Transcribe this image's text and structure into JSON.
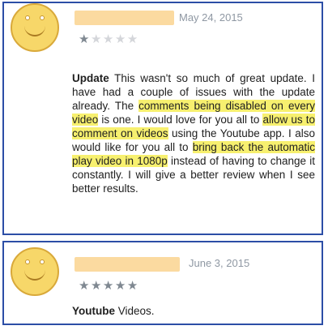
{
  "reviews": [
    {
      "date": "May 24, 2015",
      "rating": 1,
      "title": "Update",
      "segments": [
        {
          "text": " This wasn't so much of great update. I have had a couple of issues with the update already. The ",
          "highlight": false
        },
        {
          "text": "comments being disabled on every video",
          "highlight": true
        },
        {
          "text": " is one. I would love for you all to ",
          "highlight": false
        },
        {
          "text": "allow us to comment on videos",
          "highlight": true
        },
        {
          "text": " using the Youtube app. I also would like for you all to ",
          "highlight": false
        },
        {
          "text": "bring back the automatic play video in 1080p",
          "highlight": true
        },
        {
          "text": " instead of having to change it constantly. I will give a better review when I see better results.",
          "highlight": false
        }
      ]
    },
    {
      "date": "June 3, 2015",
      "rating": 5,
      "title": "Youtube",
      "segments": [
        {
          "text": " Videos.",
          "highlight": false
        }
      ]
    }
  ],
  "colors": {
    "highlight": "#f7f06f",
    "border": "#2c4ea6",
    "star_filled": "#7f8891",
    "star_empty": "#d4d6da"
  },
  "icons": {
    "avatar": "smiley-face-icon",
    "star": "star-icon"
  }
}
